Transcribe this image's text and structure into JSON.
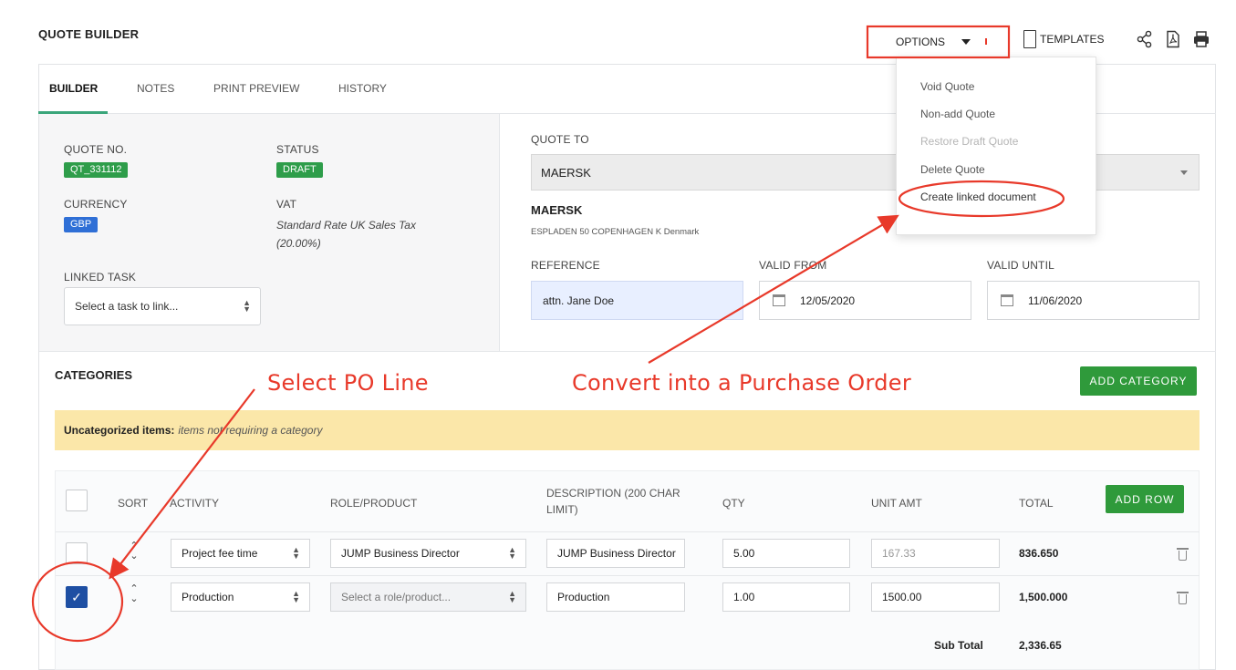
{
  "header": {
    "title": "QUOTE BUILDER",
    "options_label": "OPTIONS",
    "templates_label": "TEMPLATES"
  },
  "tabs": [
    {
      "label": "BUILDER",
      "active": true
    },
    {
      "label": "NOTES"
    },
    {
      "label": "PRINT PREVIEW"
    },
    {
      "label": "HISTORY"
    }
  ],
  "quote": {
    "quote_no_label": "QUOTE NO.",
    "quote_no": "QT_331112",
    "status_label": "STATUS",
    "status": "DRAFT",
    "currency_label": "CURRENCY",
    "currency": "GBP",
    "vat_label": "VAT",
    "vat": "Standard Rate UK Sales Tax (20.00%)",
    "linked_task_label": "LINKED TASK",
    "linked_task_placeholder": "Select a task to link...",
    "quote_to_label": "QUOTE TO",
    "quote_to": "MAERSK",
    "company_name": "MAERSK",
    "company_address": "ESPLADEN 50 COPENHAGEN K Denmark",
    "reference_label": "REFERENCE",
    "reference": "attn. Jane Doe",
    "valid_from_label": "VALID FROM",
    "valid_from": "12/05/2020",
    "valid_until_label": "VALID UNTIL",
    "valid_until": "11/06/2020"
  },
  "categories": {
    "title": "CATEGORIES",
    "add_category_label": "ADD CATEGORY",
    "uncategorized_bold": "Uncategorized items:",
    "uncategorized_desc": "items not requiring a category",
    "add_row_label": "ADD ROW",
    "columns": {
      "sort": "SORT",
      "activity": "ACTIVITY",
      "role": "ROLE/PRODUCT",
      "description": "DESCRIPTION (200 CHAR LIMIT)",
      "qty": "QTY",
      "unit_amt": "UNIT AMT",
      "total": "TOTAL"
    },
    "rows": [
      {
        "checked": false,
        "activity": "Project fee time",
        "role": "JUMP Business Director",
        "description": "JUMP Business Director",
        "qty": "5.00",
        "unit_amt": "167.33",
        "total": "836.650"
      },
      {
        "checked": true,
        "activity": "Production",
        "role": "Select a role/product...",
        "description": "Production",
        "qty": "1.00",
        "unit_amt": "1500.00",
        "total": "1,500.000"
      }
    ],
    "subtotal_label": "Sub Total",
    "subtotal": "2,336.65"
  },
  "options_menu": {
    "items": [
      {
        "label": "Void Quote",
        "enabled": true
      },
      {
        "label": "Non-add Quote",
        "enabled": true
      },
      {
        "label": "Restore Draft Quote",
        "enabled": false
      },
      {
        "label": "Delete Quote",
        "enabled": true
      },
      {
        "label": "Create linked document",
        "enabled": true
      }
    ]
  },
  "annotations": {
    "select_po": "Select PO Line",
    "convert": "Convert into a Purchase Order",
    "color": "#e8392a"
  },
  "icons": [
    "share-icon",
    "pdf-icon",
    "print-icon",
    "calendar-icon",
    "trash-icon",
    "chevron-up-icon",
    "chevron-down-icon"
  ]
}
